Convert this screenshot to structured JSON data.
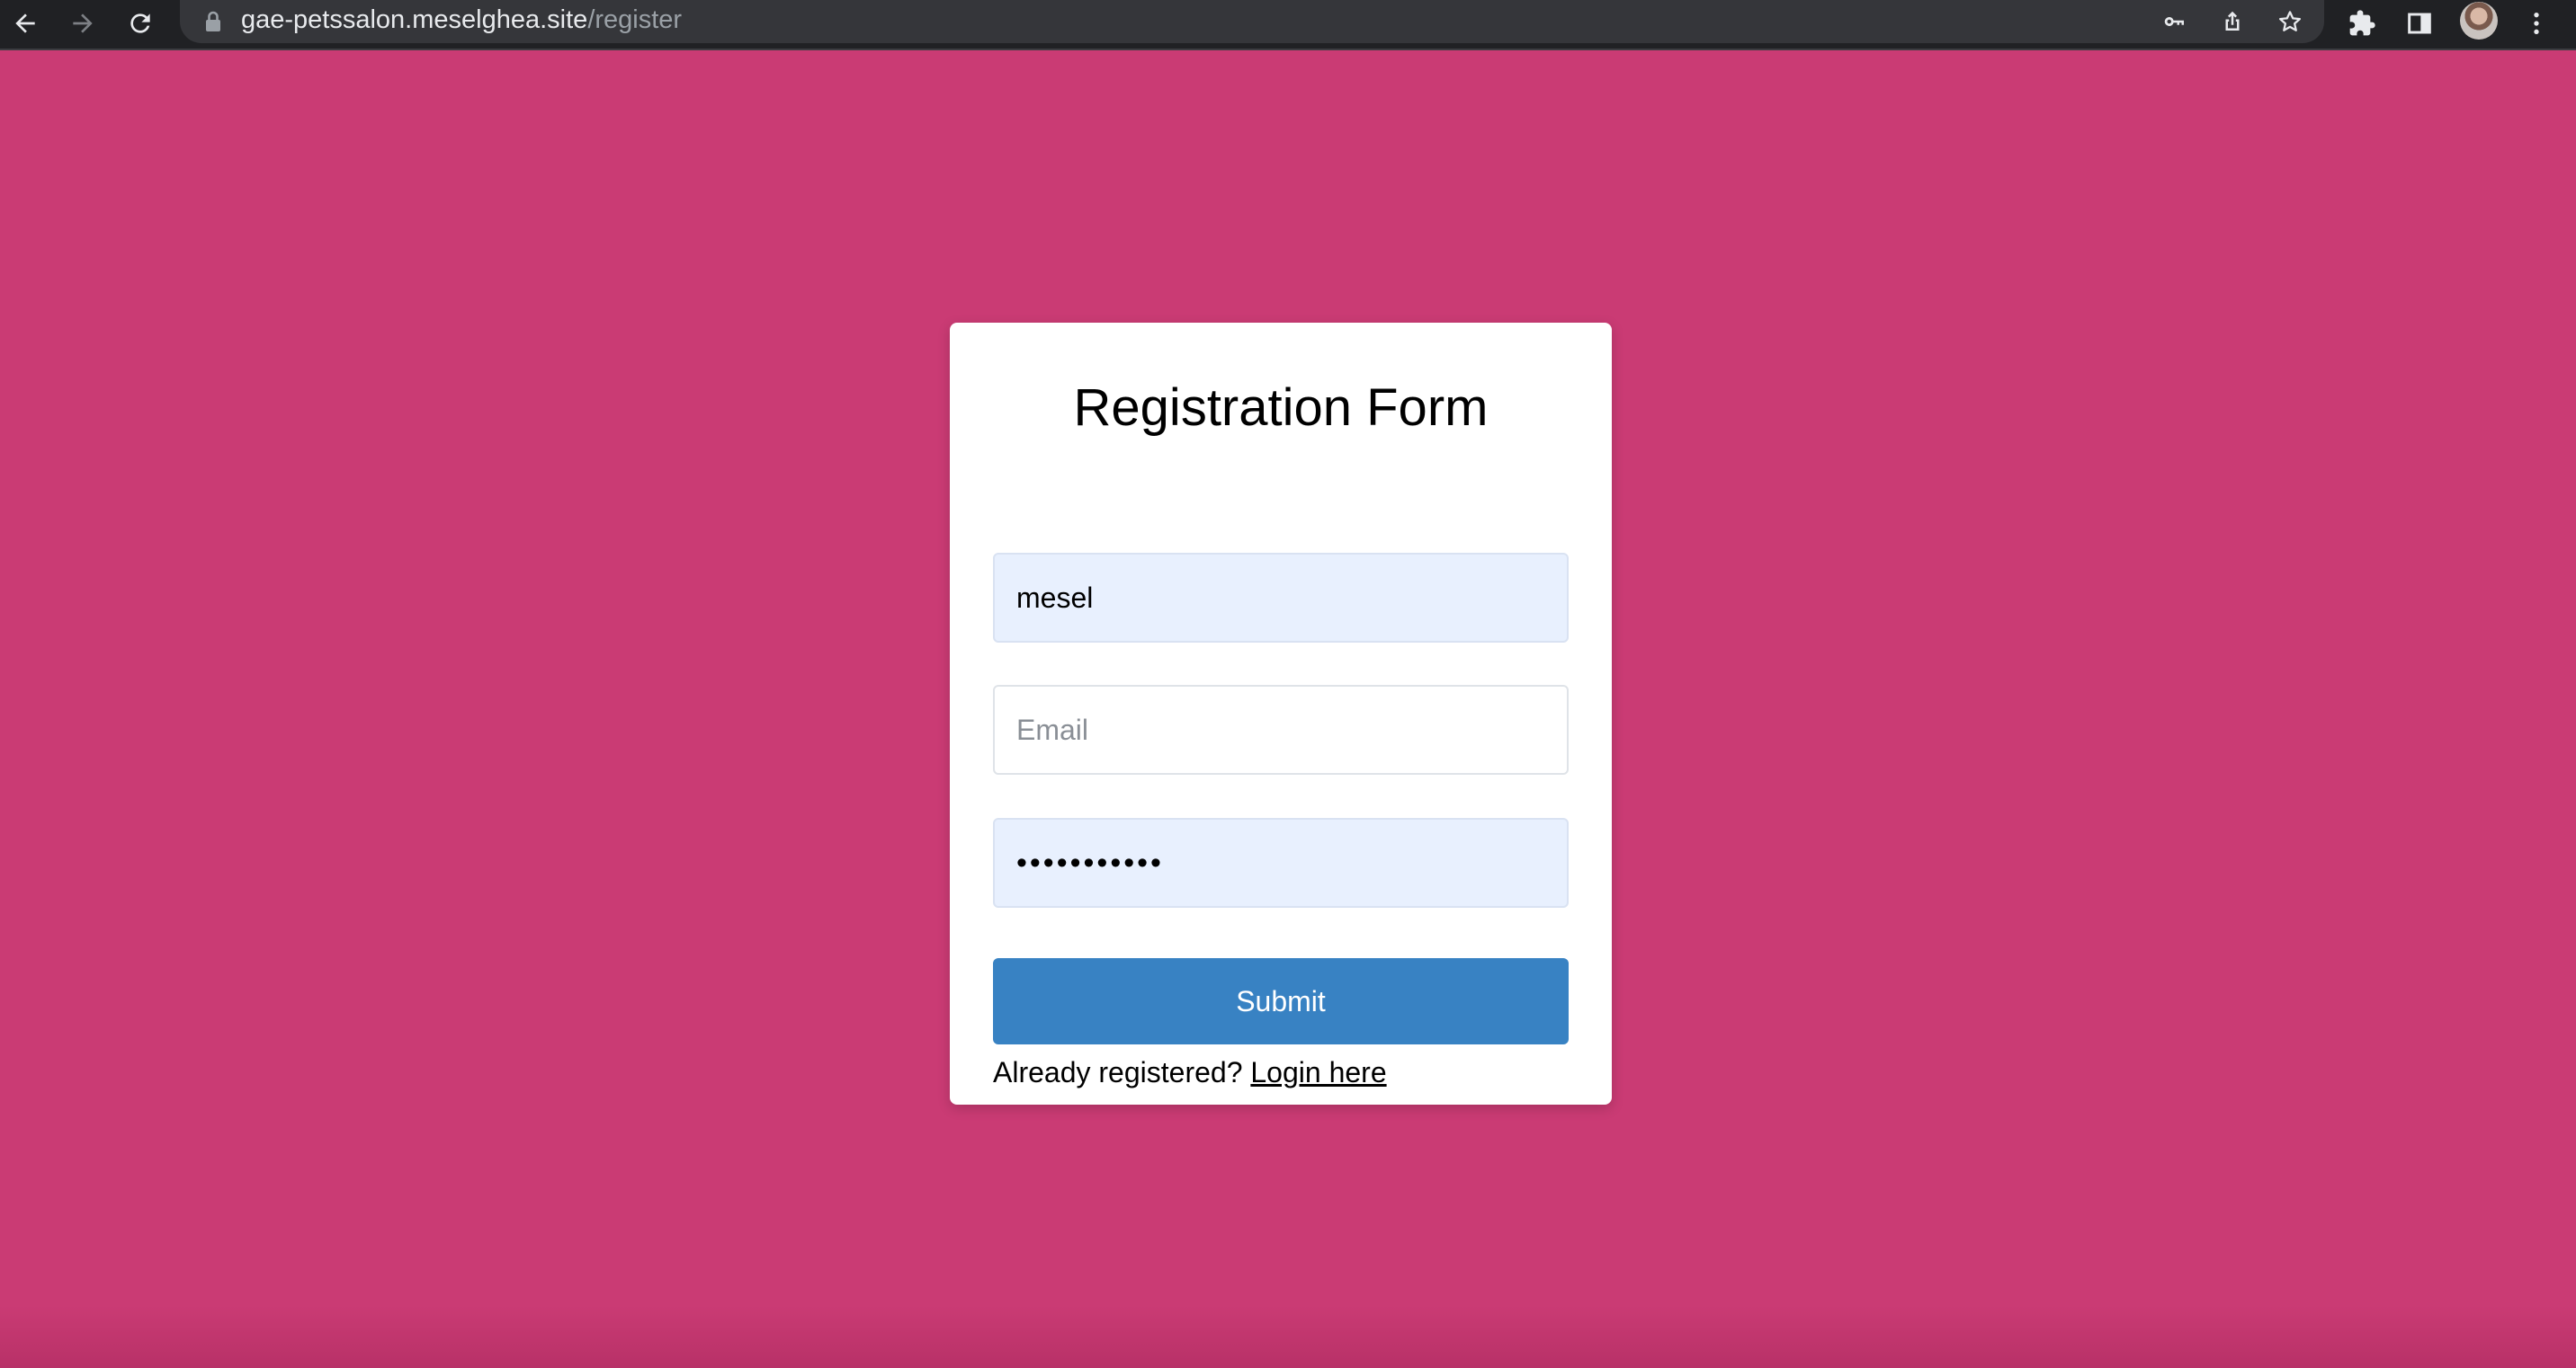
{
  "browser": {
    "url_host": "gae-petssalon.meselghea.site",
    "url_path": "/register",
    "icons": {
      "back": "back-arrow-icon",
      "forward": "forward-arrow-icon",
      "reload": "reload-icon",
      "lock": "lock-icon",
      "key": "key-icon",
      "share": "share-icon",
      "star": "bookmark-star-icon",
      "extensions": "puzzle-icon",
      "side_panel": "side-panel-icon",
      "profile": "avatar",
      "menu": "kebab-menu-icon"
    }
  },
  "form": {
    "title": "Registration Form",
    "username_value": "mesel",
    "email_placeholder": "Email",
    "email_value": "",
    "password_value": "***********",
    "submit_label": "Submit",
    "already_registered_text": "Already registered?",
    "login_link_text": "Login here"
  },
  "colors": {
    "page_background": "#ca3b74",
    "card_background": "#ffffff",
    "button_background": "#3882c3",
    "autofill_background": "#e8f0fe",
    "chrome_background": "#202124"
  }
}
